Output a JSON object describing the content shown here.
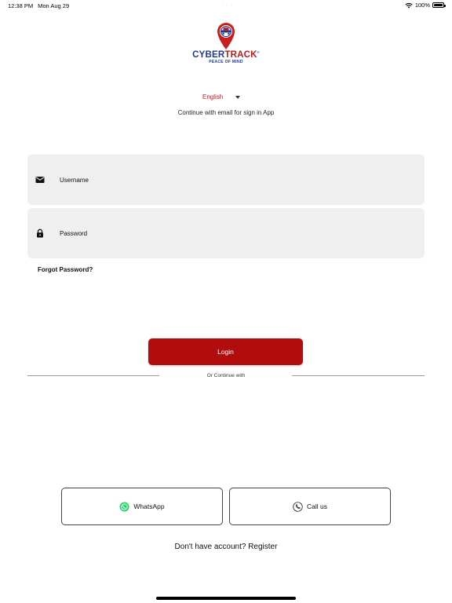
{
  "status_bar": {
    "time": "12:38 PM",
    "date": "Mon Aug 29",
    "dots": "· · ·",
    "battery": "100%"
  },
  "logo": {
    "word_left": "CYBER",
    "word_right": "TRACK",
    "registered": "®",
    "tagline": "PEACE OF MIND"
  },
  "language": {
    "selected": "English"
  },
  "subtitle": "Continue with email for sign in App",
  "form": {
    "username_label": "Username",
    "password_label": "Password",
    "forgot_label": "Forgot Password?",
    "login_label": "Login"
  },
  "divider_text": "Or Continue with",
  "social": {
    "whatsapp_label": "WhatsApp",
    "call_label": "Call us"
  },
  "register": {
    "prompt": "Don't have account?",
    "link": "Register"
  },
  "colors": {
    "brand_red": "#b10d0d",
    "brand_blue": "#1e3a8a",
    "field_bg": "#efefef",
    "whatsapp_green": "#25d366"
  }
}
